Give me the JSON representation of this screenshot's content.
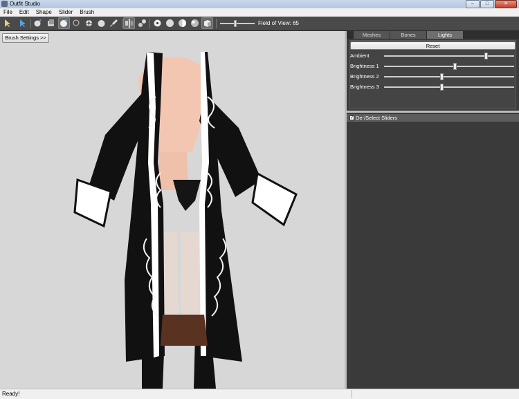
{
  "window": {
    "title": "Outfit Studio"
  },
  "menu": [
    "File",
    "Edit",
    "Shape",
    "Slider",
    "Brush"
  ],
  "toolbar": {
    "fov_label": "Field of View: 65",
    "fov_value": 65
  },
  "viewport": {
    "brush_settings_label": "Brush Settings >>"
  },
  "tabs": [
    {
      "label": "Meshes",
      "active": false
    },
    {
      "label": "Bones",
      "active": false
    },
    {
      "label": "Lights",
      "active": true
    }
  ],
  "lights": {
    "reset_label": "Reset",
    "sliders": [
      {
        "label": "Ambient",
        "level": 0.78
      },
      {
        "label": "Brightness 1",
        "level": 0.54
      },
      {
        "label": "Brightness 2",
        "level": 0.44
      },
      {
        "label": "Brightness 3",
        "level": 0.44
      }
    ]
  },
  "sliders_panel": {
    "toggle_label": "De-/Select Sliders",
    "checked": true
  },
  "status": {
    "text": "Ready!"
  },
  "colors": {
    "toolbar": "#4a4a4a",
    "viewport": "#d7d7d7",
    "panel": "#3c3c3c"
  }
}
